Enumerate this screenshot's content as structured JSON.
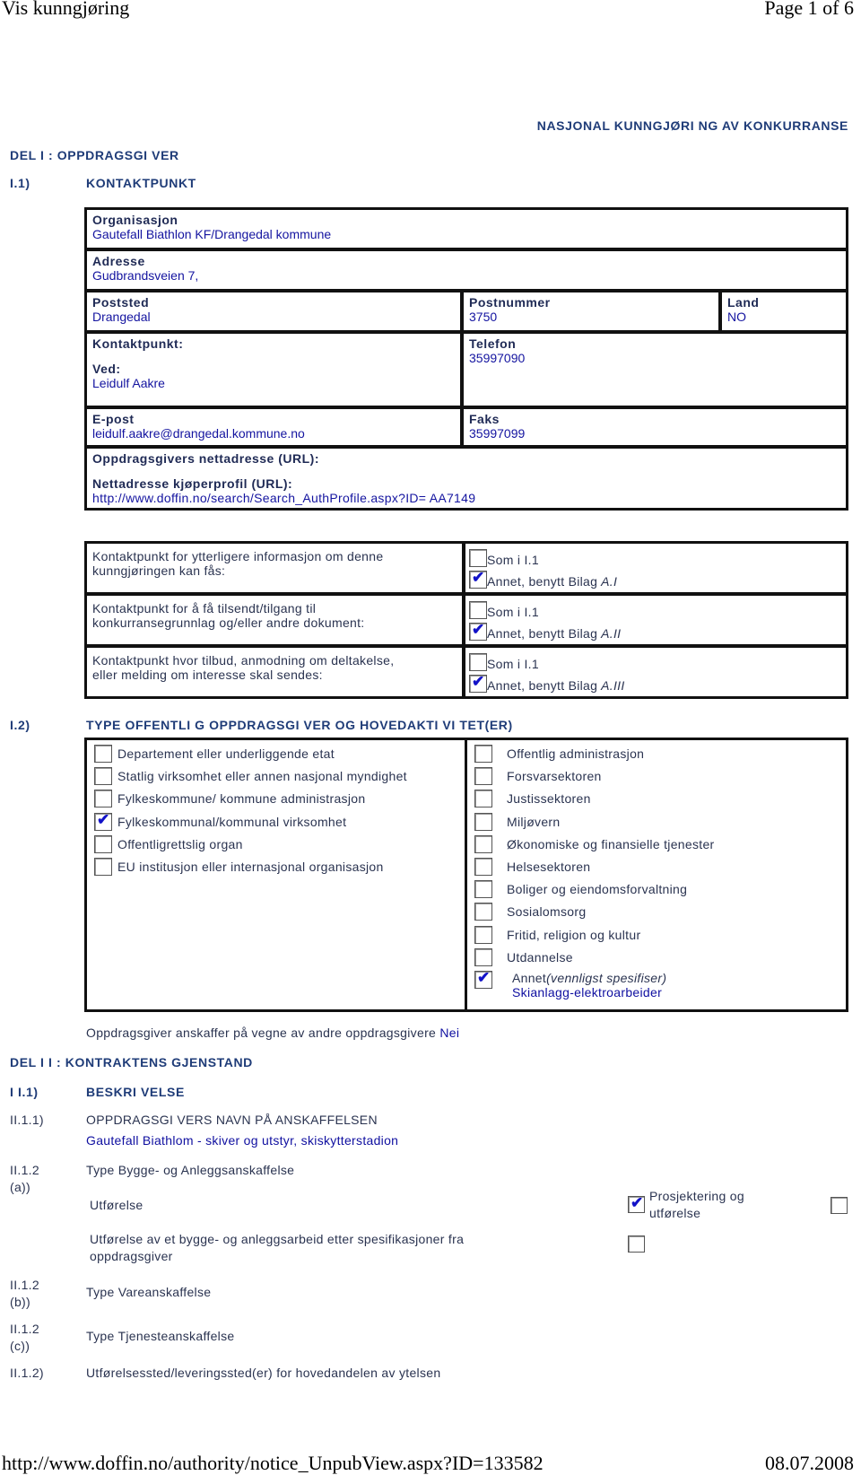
{
  "page_header": {
    "title": "Vis kunngjøring",
    "page": "Page 1 of 6"
  },
  "notice_type": "NASJONAL KUNNGJØRI NG AV KONKURRANSE",
  "part1": {
    "title": "DEL I : OPPDRAGSGI VER",
    "s11": {
      "num": "I.1)",
      "title": "KONTAKTPUNKT"
    },
    "contact": {
      "org_label": "Organisasjon",
      "org_value": "Gautefall Biathlon KF/Drangedal kommune",
      "address_label": "Adresse",
      "address_value": "Gudbrandsveien 7,",
      "city_label": "Poststed",
      "city_value": "Drangedal",
      "postcode_label": "Postnummer",
      "postcode_value": "3750",
      "country_label": "Land",
      "country_value": "NO",
      "contactpoint_label": "Kontaktpunkt:",
      "attention_label": "Ved:",
      "attention_value": "Leidulf Aakre",
      "phone_label": "Telefon",
      "phone_value": "35997090",
      "email_label": "E-post",
      "email_value": "leidulf.aakre@drangedal.kommune.no",
      "fax_label": "Faks",
      "fax_value": "35997099",
      "url_label": "Oppdragsgivers nettadresse (URL):",
      "buyer_url_label": "Nettadresse kjøperprofil (URL):",
      "buyer_url_value": "http://www.doffin.no/search/Search_AuthProfile.aspx?ID= AA7149"
    },
    "contact_points": [
      {
        "text1": "Kontaktpunkt for ytterligere informasjon om denne",
        "text2": "kunngjøringen kan fås:",
        "opt1": "Som i I.1",
        "opt1_checked": false,
        "opt2": "Annet, benytt Bilag",
        "opt2_ref": "A.I",
        "opt2_checked": true
      },
      {
        "text1": "Kontaktpunkt for å få tilsendt/tilgang til",
        "text2": "konkurransegrunnlag og/eller andre dokument:",
        "opt1": "Som i I.1",
        "opt1_checked": false,
        "opt2": "Annet, benytt Bilag",
        "opt2_ref": "A.II",
        "opt2_checked": true
      },
      {
        "text1": "Kontaktpunkt hvor tilbud, anmodning om deltakelse,",
        "text2": "eller melding om interesse skal sendes:",
        "opt1": "Som i I.1",
        "opt1_checked": false,
        "opt2": "Annet, benytt Bilag",
        "opt2_ref": "A.III",
        "opt2_checked": true
      }
    ],
    "s12": {
      "num": "I.2)",
      "title": "TYPE OFFENTLI G OPPDRAGSGI VER OG HOVEDAKTI VI TET(ER)"
    },
    "authority_types": [
      {
        "label": "Departement eller underliggende etat",
        "checked": false
      },
      {
        "label": "Statlig virksomhet eller annen nasjonal myndighet",
        "checked": false
      },
      {
        "label": "Fylkeskommune/ kommune administrasjon",
        "checked": false
      },
      {
        "label": "Fylkeskommunal/kommunal virksomhet",
        "checked": true
      },
      {
        "label": "Offentligrettslig organ",
        "checked": false
      },
      {
        "label": "EU institusjon eller internasjonal organisasjon",
        "checked": false
      }
    ],
    "activities": [
      {
        "label": "Offentlig administrasjon",
        "checked": false
      },
      {
        "label": "Forsvarsektoren",
        "checked": false
      },
      {
        "label": "Justissektoren",
        "checked": false
      },
      {
        "label": "Miljøvern",
        "checked": false
      },
      {
        "label": "Økonomiske og finansielle tjenester",
        "checked": false
      },
      {
        "label": "Helsesektoren",
        "checked": false
      },
      {
        "label": "Boliger og eiendomsforvaltning",
        "checked": false
      },
      {
        "label": "Sosialomsorg",
        "checked": false
      },
      {
        "label": "Fritid, religion og kultur",
        "checked": false
      },
      {
        "label": "Utdannelse",
        "checked": false
      }
    ],
    "activity_other": {
      "label": "Annet",
      "hint": "(vennligst spesifiser)",
      "value": "Skianlagg-elektroarbeider",
      "checked": true
    },
    "on_behalf_label": "Oppdragsgiver anskaffer på vegne av andre oppdragsgivere",
    "on_behalf_value": "Nei"
  },
  "part2": {
    "title": "DEL I I : KONTRAKTENS GJENSTAND",
    "s21": {
      "num": "I I.1)",
      "title": "BESKRI VELSE"
    },
    "s211": {
      "num": "II.1.1)",
      "title": "OPPDRAGSGI VERS NAVN PÅ ANSKAFFELSEN",
      "value": "Gautefall Biathlom - skiver og utstyr, skiskytterstadion"
    },
    "s212a": {
      "num1": "II.1.2",
      "num2": "(a))",
      "title": "Type Bygge- og Anleggsanskaffelse",
      "opt_execution": "Utførelse",
      "opt_execution_checked": false,
      "opt_design": "Prosjektering og",
      "opt_design2": "utførelse",
      "opt_design_checked": true,
      "opt_spec": "Utførelse av et bygge- og anleggsarbeid etter spesifikasjoner fra",
      "opt_spec2": "oppdragsgiver",
      "opt_spec_checked": false
    },
    "s212b": {
      "num1": "II.1.2",
      "num2": "(b))",
      "title": "Type Vareanskaffelse"
    },
    "s212c": {
      "num1": "II.1.2",
      "num2": "(c))",
      "title": "Type Tjenesteanskaffelse"
    },
    "s2122": {
      "num": "II.1.2)",
      "title": "Utførelsessted/leveringssted(er) for hovedandelen av ytelsen"
    }
  },
  "page_footer": {
    "url": "http://www.doffin.no/authority/notice_UnpubView.aspx?ID=133582",
    "date": "08.07.2008"
  }
}
